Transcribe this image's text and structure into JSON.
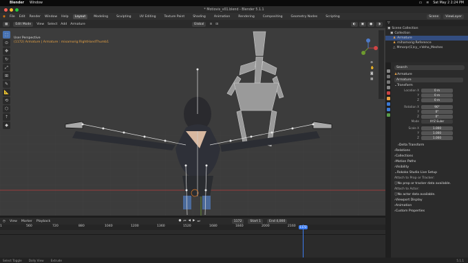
{
  "mac": {
    "app": "Blender",
    "menu": "Window",
    "datetime": "Sat May 2  2:24 PM"
  },
  "window": {
    "title": "* Motiovis_v01.blend - Blender 5.1.1"
  },
  "menus": [
    "File",
    "Edit",
    "Render",
    "Window",
    "Help"
  ],
  "workspaces": [
    "Layout",
    "Modeling",
    "Sculpting",
    "UV Editing",
    "Texture Paint",
    "Shading",
    "Animation",
    "Rendering",
    "Compositing",
    "Geometry Nodes",
    "Scripting"
  ],
  "header_right": {
    "scene": "Scene",
    "viewlayer": "ViewLayer"
  },
  "vp_header": {
    "mode": "Edit Mode",
    "view": "View",
    "select": "Select",
    "add": "Add",
    "armature": "Armature",
    "orientation": "Global",
    "options": "Options"
  },
  "viewport": {
    "perspective": "User Perspective",
    "context": "(1172) Armature | Armature : mixamorig:RightHandThumb1"
  },
  "outliner": {
    "rows": [
      "Scene Collection",
      "Collection",
      "Armature",
      "mihamorig:Reference",
      "Mmorpr(1)cy_+Veha_Meshes"
    ]
  },
  "props": {
    "search_placeholder": "Search",
    "object": "Armature",
    "datablock": "Armature",
    "transform": "Transform",
    "location": {
      "label": "Location X",
      "x": "0 m",
      "y": "0 m",
      "z": "0 m"
    },
    "rotation": {
      "label": "Rotation X",
      "x": "90°",
      "y": "0°",
      "z": "0°"
    },
    "mode": {
      "label": "Mode",
      "value": "XYZ Euler"
    },
    "scale": {
      "label": "Scale X",
      "x": "1.000",
      "y": "1.000",
      "z": "1.000"
    },
    "axis": {
      "y": "Y",
      "z": "Z"
    },
    "sections": [
      "Delta Transform",
      "Relations",
      "Collections",
      "Motion Paths",
      "Visibility",
      "Rokoko Studio Live Setup"
    ],
    "attach_label": "Attach to Prop or Tracker:",
    "attach_value": "No prop or tracker data available.",
    "actor_label": "Attach to Actor:",
    "actor_value": "No actor data available.",
    "sections2": [
      "Viewport Display",
      "Animation",
      "Custom Properties"
    ]
  },
  "timeline": {
    "view": "View",
    "marker": "Marker",
    "playback": "Playback",
    "current": "1172",
    "start_label": "Start",
    "start": "1",
    "end_label": "End",
    "end": "4,000",
    "ticks": [
      "1",
      "560",
      "720",
      "880",
      "1040",
      "1200",
      "1360",
      "1520",
      "1680",
      "1840",
      "2000",
      "2160"
    ]
  },
  "status": {
    "items": [
      "Select Toggle",
      "Dolly View",
      "Extrude"
    ],
    "version": "5.1.1"
  },
  "colors": {
    "accent": "#4772b3",
    "axis_red": "#b83e3e",
    "axis_green": "#6e9a2e",
    "playhead": "#3d7df2"
  }
}
